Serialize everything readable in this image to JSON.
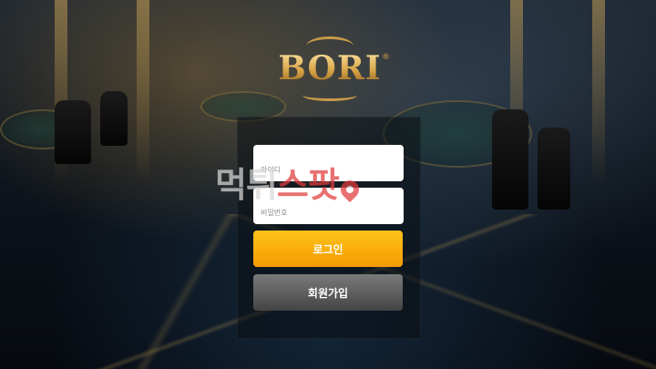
{
  "brand": {
    "name": "BORI",
    "registered_mark": "®"
  },
  "login_form": {
    "id_placeholder": "아이디",
    "password_placeholder": "비밀번호",
    "login_button": "로그인",
    "signup_button": "회원가입"
  },
  "watermark": {
    "part1": "먹튀",
    "part2": "스팟"
  },
  "colors": {
    "login_button": "#f5a300",
    "signup_button": "#5a5a5a",
    "logo_gold": "#d9a548",
    "watermark_red": "#e23b3b"
  },
  "icons": [
    "location-pin-icon"
  ]
}
